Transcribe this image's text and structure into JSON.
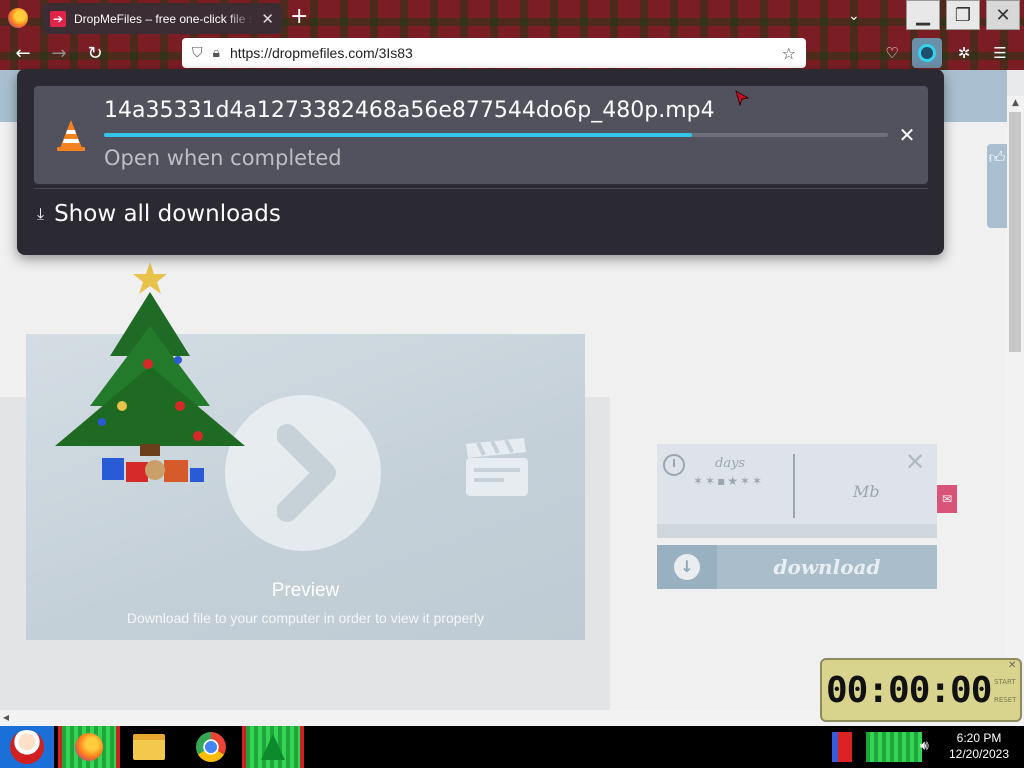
{
  "browser": {
    "tab": {
      "title": "DropMeFiles – free one-click file s",
      "favicon": "dropmefiles-arrow-icon"
    },
    "url": "https://dropmefiles.com/3Is83",
    "icons": [
      "back-icon",
      "forward-icon",
      "reload-icon",
      "shield-icon",
      "lock-icon",
      "star-icon",
      "pocket-icon",
      "downloads-icon",
      "extensions-icon",
      "menu-icon"
    ]
  },
  "downloads": {
    "filename": "14a35331d4a1273382468a56e877544do6p_480p.mp4",
    "status": "Open when completed",
    "progress_percent": 75,
    "show_all_label": "Show all downloads",
    "accent_color": "#33c6e8"
  },
  "page": {
    "preview_title": "Preview",
    "preview_subtitle": "Download file to your computer in order to view it properly",
    "timer_days_label": "days",
    "timer_size_label": "Mb",
    "download_label": "download"
  },
  "stopwatch": {
    "time": "00:00:00",
    "start_label": "START",
    "reset_label": "RESET"
  },
  "taskbar": {
    "time": "6:20 PM",
    "date": "12/20/2023"
  }
}
